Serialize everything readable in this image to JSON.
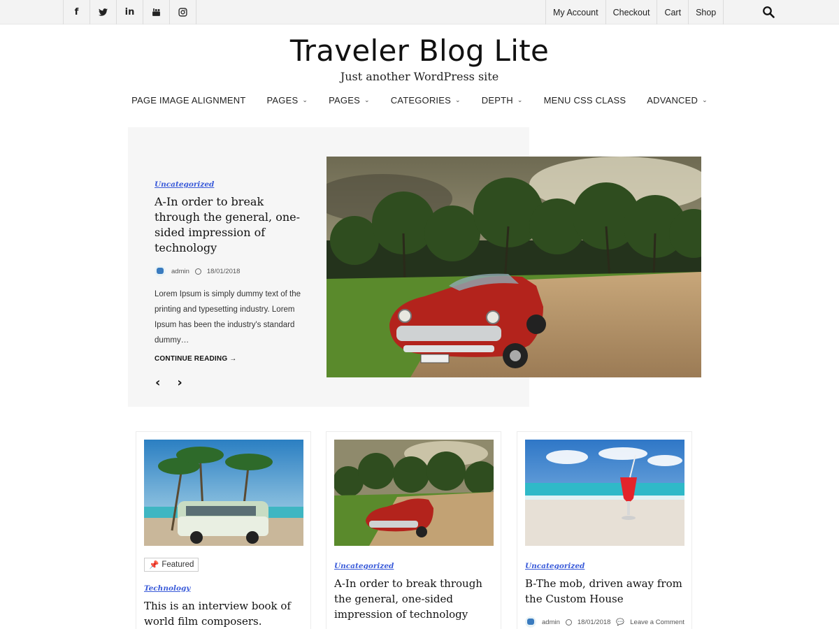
{
  "topbar": {
    "social": [
      {
        "icon": "facebook-icon",
        "glyph": "f"
      },
      {
        "icon": "twitter-icon",
        "glyph": ""
      },
      {
        "icon": "linkedin-icon",
        "glyph": "in"
      },
      {
        "icon": "youtube-icon",
        "glyph": ""
      },
      {
        "icon": "instagram-icon",
        "glyph": ""
      }
    ],
    "links": [
      "My Account",
      "Checkout",
      "Cart",
      "Shop"
    ]
  },
  "header": {
    "title": "Traveler Blog Lite",
    "tagline": "Just another WordPress site"
  },
  "nav": {
    "items": [
      {
        "label": "PAGE IMAGE ALIGNMENT",
        "dropdown": false
      },
      {
        "label": "PAGES",
        "dropdown": true
      },
      {
        "label": "PAGES",
        "dropdown": true
      },
      {
        "label": "CATEGORIES",
        "dropdown": true
      },
      {
        "label": "DEPTH",
        "dropdown": true
      },
      {
        "label": "MENU CSS CLASS",
        "dropdown": false
      },
      {
        "label": "ADVANCED",
        "dropdown": true
      }
    ],
    "chevron": "⌄"
  },
  "slider": {
    "category": "Uncategorized",
    "title": "A-In order to break through the general, one-sided impression of technology",
    "author": "admin",
    "date": "18/01/2018",
    "excerpt": "Lorem Ipsum is simply dummy text of the printing and typesetting industry. Lorem Ipsum has been the industry's standard dummy…",
    "continue_label": "CONTINUE READING →",
    "prev": "‹",
    "next": "›"
  },
  "cards": [
    {
      "badge": "Featured",
      "category": "Technology",
      "title": "This is an interview book of world film composers."
    },
    {
      "category": "Uncategorized",
      "title": "A-In order to break through the general, one-sided impression of technology"
    },
    {
      "category": "Uncategorized",
      "title": "B-The mob, driven away from the Custom House",
      "author": "admin",
      "date": "18/01/2018",
      "comment": "Leave a Comment"
    }
  ],
  "colors": {
    "accent_blue": "#3a5bd9",
    "topbar_bg": "#f3f3f3",
    "slider_bg": "#f6f6f6"
  }
}
